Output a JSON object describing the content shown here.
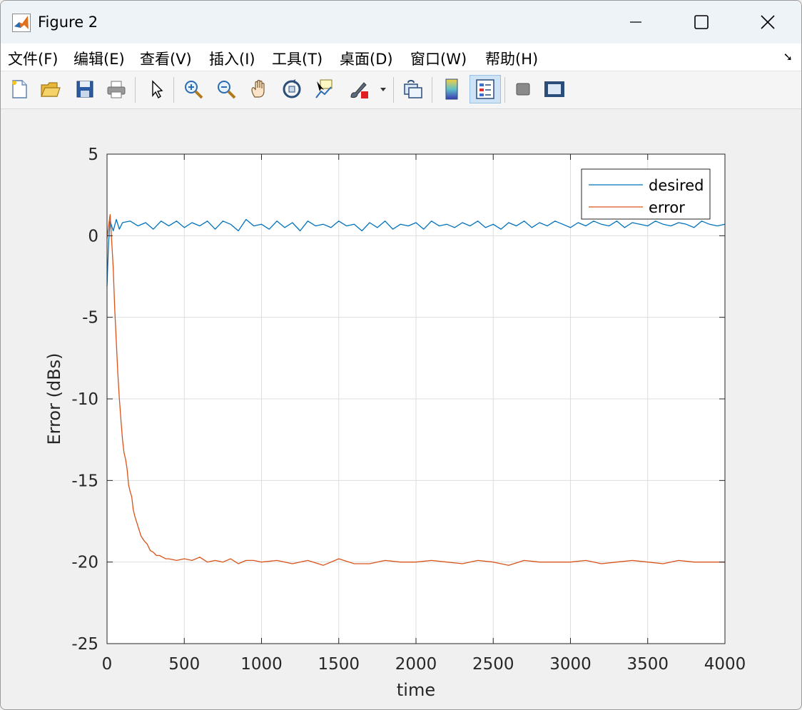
{
  "window": {
    "title": "Figure 2"
  },
  "menu": [
    "文件(F)",
    "编辑(E)",
    "查看(V)",
    "插入(I)",
    "工具(T)",
    "桌面(D)",
    "窗口(W)",
    "帮助(H)"
  ],
  "toolbar": {
    "icons": [
      "new-figure-icon",
      "open-file-icon",
      "save-icon",
      "print-icon",
      "pointer-icon",
      "zoom-in-icon",
      "zoom-out-icon",
      "pan-hand-icon",
      "rotate-3d-icon",
      "data-cursor-icon",
      "brush-icon",
      "link-plot-icon",
      "colorbar-icon",
      "legend-icon",
      "hide-plot-tools-icon",
      "show-plot-tools-icon"
    ],
    "active": "legend-icon"
  },
  "chart_data": {
    "type": "line",
    "title": "",
    "xlabel": "time",
    "ylabel": "Error (dBs)",
    "xlim": [
      0,
      4000
    ],
    "ylim": [
      -25,
      5
    ],
    "xticks": [
      0,
      500,
      1000,
      1500,
      2000,
      2500,
      3000,
      3500,
      4000
    ],
    "yticks": [
      5,
      0,
      -5,
      -10,
      -15,
      -20,
      -25
    ],
    "grid": true,
    "legend_position": "top-right",
    "colors": {
      "desired": "#0072BD",
      "error": "#D95319"
    },
    "series": [
      {
        "name": "desired",
        "color": "#0072BD",
        "x": [
          0,
          10,
          20,
          40,
          60,
          80,
          100,
          150,
          200,
          250,
          300,
          350,
          400,
          450,
          500,
          550,
          600,
          650,
          700,
          750,
          800,
          850,
          900,
          950,
          1000,
          1050,
          1100,
          1150,
          1200,
          1250,
          1300,
          1350,
          1400,
          1450,
          1500,
          1550,
          1600,
          1650,
          1700,
          1750,
          1800,
          1850,
          1900,
          1950,
          2000,
          2050,
          2100,
          2150,
          2200,
          2250,
          2300,
          2350,
          2400,
          2450,
          2500,
          2550,
          2600,
          2650,
          2700,
          2750,
          2800,
          2850,
          2900,
          2950,
          3000,
          3050,
          3100,
          3150,
          3200,
          3250,
          3300,
          3350,
          3400,
          3450,
          3500,
          3550,
          3600,
          3650,
          3700,
          3750,
          3800,
          3850,
          3900,
          3950,
          4000
        ],
        "y": [
          -3.1,
          -0.4,
          0.9,
          0.3,
          1.0,
          0.4,
          0.8,
          0.9,
          0.6,
          0.8,
          0.4,
          0.9,
          0.6,
          0.9,
          0.5,
          0.8,
          0.6,
          0.9,
          0.4,
          0.9,
          0.7,
          0.3,
          1.0,
          0.6,
          0.7,
          0.4,
          0.9,
          0.5,
          0.8,
          0.3,
          0.9,
          0.6,
          0.7,
          0.5,
          0.9,
          0.6,
          0.7,
          0.3,
          0.8,
          0.5,
          0.9,
          0.4,
          0.7,
          0.6,
          0.8,
          0.4,
          0.9,
          0.6,
          0.7,
          0.5,
          0.8,
          0.6,
          0.9,
          0.5,
          0.7,
          0.4,
          0.8,
          0.6,
          0.9,
          0.5,
          0.8,
          0.6,
          0.9,
          0.7,
          0.5,
          0.8,
          0.6,
          0.9,
          0.7,
          0.6,
          0.9,
          0.5,
          0.8,
          0.7,
          0.6,
          0.9,
          0.7,
          0.6,
          0.8,
          0.7,
          0.5,
          0.9,
          0.7,
          0.6,
          0.7
        ]
      },
      {
        "name": "error",
        "color": "#D95319",
        "x": [
          0,
          10,
          20,
          30,
          40,
          50,
          60,
          70,
          80,
          90,
          100,
          110,
          120,
          130,
          140,
          150,
          160,
          170,
          180,
          200,
          220,
          240,
          260,
          280,
          300,
          320,
          340,
          360,
          380,
          400,
          450,
          500,
          550,
          600,
          650,
          700,
          750,
          800,
          850,
          900,
          950,
          1000,
          1100,
          1200,
          1300,
          1400,
          1500,
          1600,
          1700,
          1800,
          1900,
          2000,
          2100,
          2200,
          2300,
          2400,
          2500,
          2600,
          2700,
          2800,
          2900,
          3000,
          3100,
          3200,
          3300,
          3400,
          3500,
          3600,
          3700,
          3800,
          3900,
          4000
        ],
        "y": [
          -0.2,
          0.6,
          1.3,
          -0.3,
          -2.0,
          -4.5,
          -6.5,
          -8.5,
          -10.0,
          -11.3,
          -12.5,
          -13.3,
          -13.7,
          -14.3,
          -15.3,
          -15.7,
          -16.0,
          -16.8,
          -17.2,
          -17.8,
          -18.4,
          -18.7,
          -18.9,
          -19.3,
          -19.4,
          -19.6,
          -19.6,
          -19.7,
          -19.8,
          -19.8,
          -19.9,
          -19.8,
          -19.9,
          -19.7,
          -20.0,
          -19.9,
          -20.0,
          -19.8,
          -20.1,
          -19.9,
          -19.9,
          -20.0,
          -19.9,
          -20.1,
          -19.9,
          -20.2,
          -19.8,
          -20.1,
          -20.1,
          -19.9,
          -20.0,
          -20.0,
          -19.9,
          -20.0,
          -20.1,
          -19.9,
          -20.0,
          -20.2,
          -19.9,
          -20.0,
          -20.0,
          -20.0,
          -19.9,
          -20.1,
          -20.0,
          -19.9,
          -20.0,
          -20.1,
          -19.9,
          -20.0,
          -20.0,
          -20.0
        ]
      }
    ]
  }
}
